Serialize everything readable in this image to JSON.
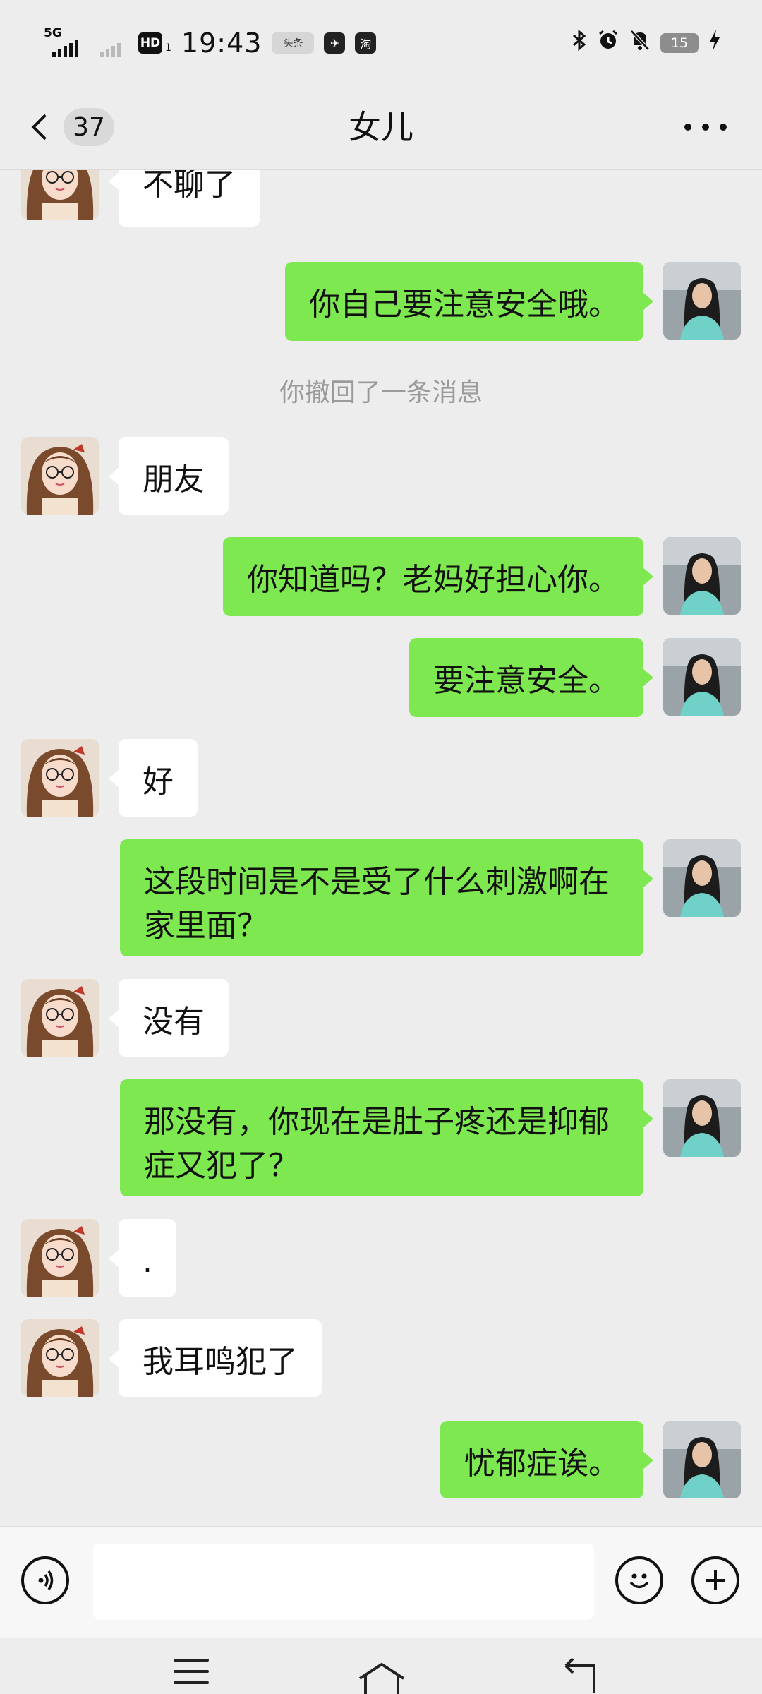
{
  "status_bar": {
    "network": "5G",
    "hd": "HD",
    "hd_sub": "1",
    "time": "19:43",
    "apps": [
      "头条",
      "✈",
      "淘"
    ],
    "battery": "15"
  },
  "header": {
    "unread_count": "37",
    "title": "女儿"
  },
  "messages": [
    {
      "dir": "in",
      "text": "不聊了"
    },
    {
      "dir": "out",
      "text": "你自己要注意安全哦。"
    },
    {
      "dir": "system",
      "text": "你撤回了一条消息"
    },
    {
      "dir": "in",
      "text": "朋友"
    },
    {
      "dir": "out",
      "text": "你知道吗？老妈好担心你。"
    },
    {
      "dir": "out",
      "text": "要注意安全。"
    },
    {
      "dir": "in",
      "text": "好"
    },
    {
      "dir": "out",
      "text": "这段时间是不是受了什么刺激啊在家里面？"
    },
    {
      "dir": "in",
      "text": "没有"
    },
    {
      "dir": "out",
      "text": "那没有，你现在是肚子疼还是抑郁症又犯了？"
    },
    {
      "dir": "in",
      "text": "."
    },
    {
      "dir": "in",
      "text": "我耳鸣犯了"
    },
    {
      "dir": "out",
      "text": "忧郁症诶。"
    }
  ],
  "input_bar": {
    "placeholder": ""
  },
  "colors": {
    "outgoing_bubble": "#7de84f",
    "incoming_bubble": "#ffffff",
    "background": "#ededed"
  },
  "icons": {
    "voice": "voice-icon",
    "emoji": "emoji-icon",
    "plus": "plus-icon",
    "back": "chevron-left-icon",
    "more": "more-dots-icon"
  }
}
